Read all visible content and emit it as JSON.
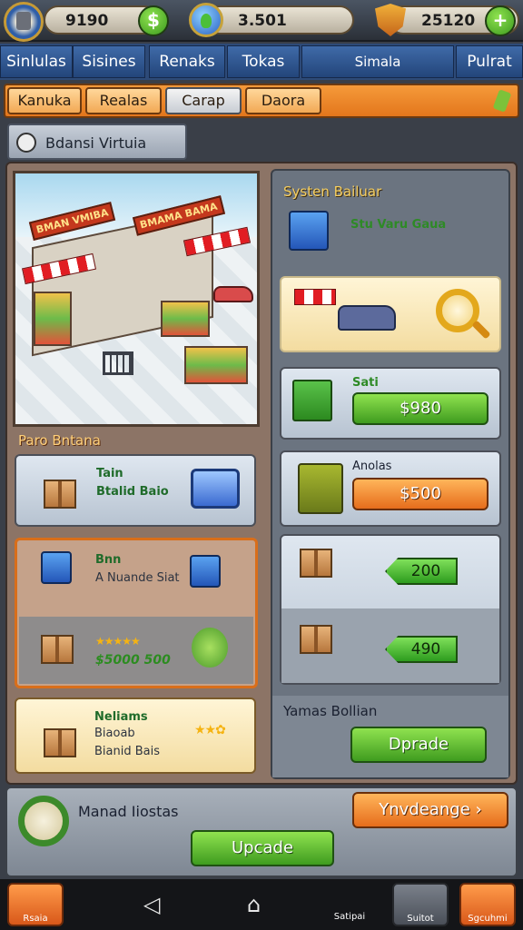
{
  "topbar": {
    "coins": "9190",
    "gems": "3.501",
    "trophies": "25120"
  },
  "tabs": [
    "Sinlulas",
    "Sisines",
    "Renaks",
    "Tokas",
    "Simala",
    "Pulrat"
  ],
  "subtabs": [
    "Kanuka",
    "Realas",
    "Carap",
    "Daora"
  ],
  "section_title": "Bdansi Virtuia",
  "scene": {
    "sign1": "BMAN VMIBA",
    "sign2": "BMAMA BAMA"
  },
  "left": {
    "caption": "Paro Bntana",
    "card1": {
      "line1": "Tain",
      "line2": "Btalid Baio"
    },
    "card2": {
      "line1": "Bnn",
      "line2": "A Nuande Siat",
      "stars": "★★★★★",
      "price": "$5000 500"
    },
    "card3": {
      "line1": "Neliams",
      "line2": "Biaoab",
      "line3": "Bianid Bais"
    }
  },
  "right": {
    "title": "Systen Bailuar",
    "item1": "Stu Varu Gaua",
    "item2_label": "Sati",
    "item2_button": "$980",
    "item3_label": "Anolas",
    "item3_button": "$500",
    "tag1": "200",
    "tag2": "490",
    "footer_title": "Yamas Bollian",
    "footer_button": "Dprade"
  },
  "info": {
    "label": "Manad Iiostas",
    "upgrade": "Upcade",
    "advantage": "Ynvdeange"
  },
  "navbar": {
    "home": "Rsaia",
    "store": "Satipai",
    "stats": "Suitot",
    "settings": "Sgcuhmi"
  },
  "icons": {
    "top_left": "avatar-icon",
    "coins": "coin-icon",
    "gems": "globe-icon",
    "trophies": "shield-icon",
    "add": "plus-icon",
    "back": "back-icon",
    "home": "home-icon",
    "recent": "recent-icon"
  }
}
